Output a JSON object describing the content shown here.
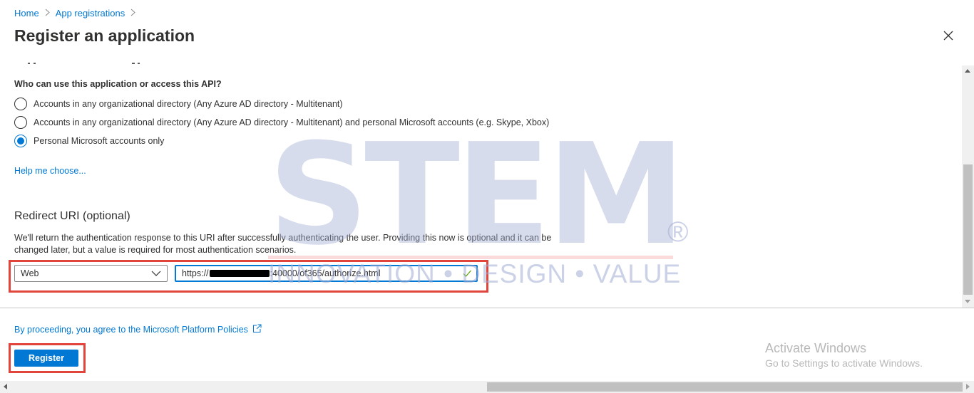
{
  "breadcrumb": {
    "items": [
      "Home",
      "App registrations"
    ],
    "separator": ">"
  },
  "header": {
    "title": "Register an application",
    "close_icon": "close-icon"
  },
  "account_types": {
    "question": "Who can use this application or access this API?",
    "options": [
      {
        "label": "Accounts in any organizational directory (Any Azure AD directory - Multitenant)",
        "checked": false
      },
      {
        "label": "Accounts in any organizational directory (Any Azure AD directory - Multitenant) and personal Microsoft accounts (e.g. Skype, Xbox)",
        "checked": false
      },
      {
        "label": "Personal Microsoft accounts only",
        "checked": true
      }
    ],
    "help_link": "Help me choose..."
  },
  "redirect_uri": {
    "title": "Redirect URI (optional)",
    "description": "We'll return the authentication response to this URI after successfully authenticating the user. Providing this now is optional and it can be changed later, but a value is required for most authentication scenarios.",
    "platform_selected": "Web",
    "uri_prefix": "https://",
    "uri_suffix": ":40000/of365/authorize.html",
    "uri_redacted": true,
    "valid_icon": "checkmark-icon"
  },
  "footer": {
    "policy_link": "By proceeding, you agree to the Microsoft Platform Policies",
    "policy_icon": "external-link-icon",
    "register_label": "Register"
  },
  "watermark": {
    "letters": "STEM",
    "registered": "®",
    "tagline": "INNOVATION • DESIGN • VALUE"
  },
  "os_overlay": {
    "line1": "Activate Windows",
    "line2": "Go to Settings to activate Windows."
  },
  "colors": {
    "accent": "#0078d4",
    "annotation_red": "#e0443a",
    "text": "#323130"
  }
}
